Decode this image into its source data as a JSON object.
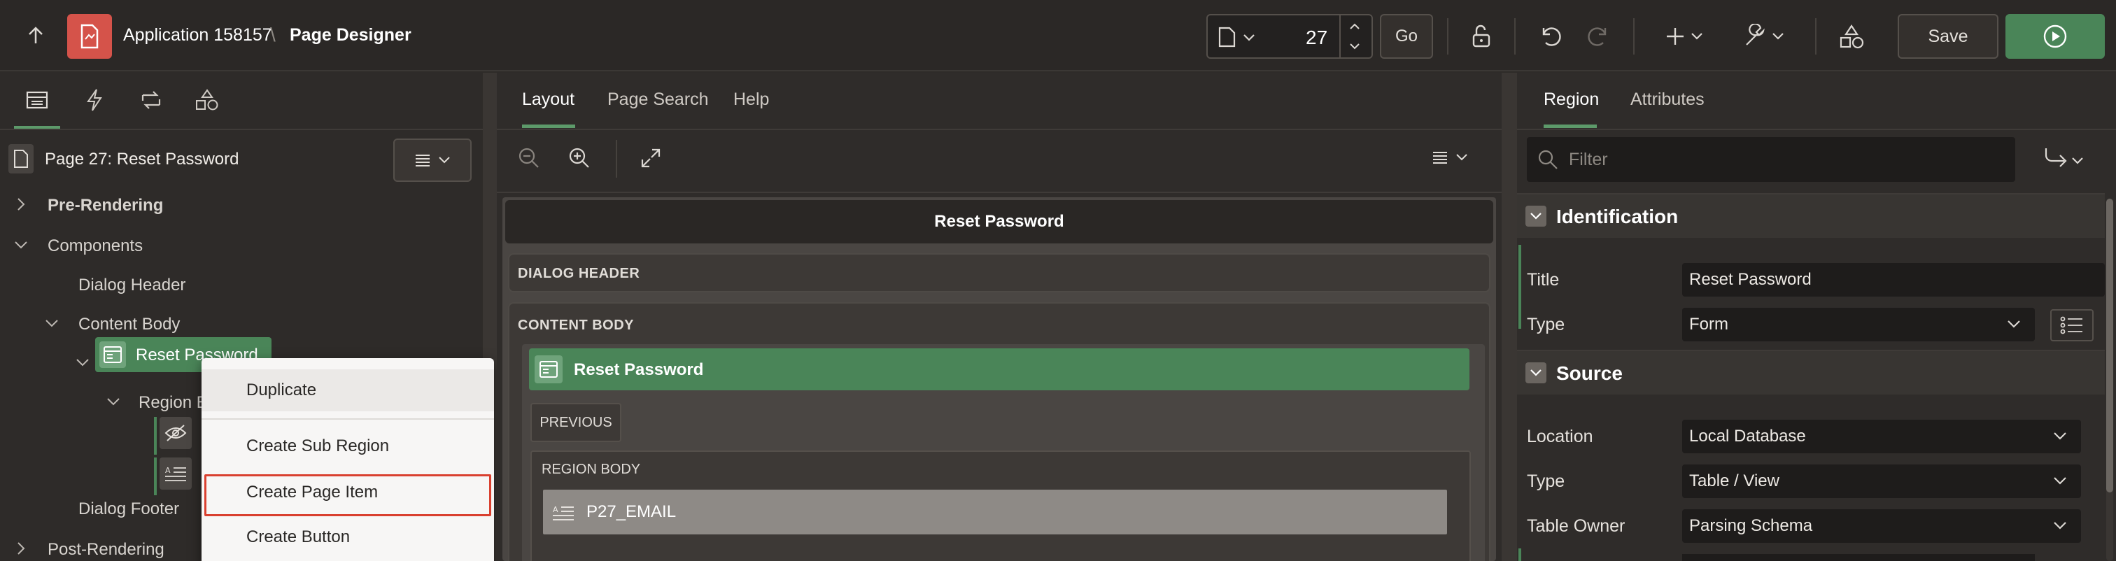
{
  "header": {
    "app_name": "Application 158157",
    "separator": "\\",
    "page_designer": "Page Designer",
    "page_number": "27",
    "go_label": "Go",
    "save_label": "Save"
  },
  "left": {
    "tabs": [
      "rendering-icon",
      "dynamic-actions-icon",
      "processing-icon",
      "shared-components-icon"
    ],
    "page_title": "Page 27: Reset Password",
    "tree": {
      "pre_rendering": "Pre-Rendering",
      "components": "Components",
      "dialog_header": "Dialog Header",
      "content_body": "Content Body",
      "reset_password": "Reset Password",
      "region_body": "Region B",
      "dialog_footer": "Dialog Footer",
      "post_rendering": "Post-Rendering"
    }
  },
  "context_menu": {
    "items": [
      "Duplicate",
      "Create Sub Region",
      "Create Page Item",
      "Create Button"
    ]
  },
  "middle": {
    "tabs": {
      "layout": "Layout",
      "page_search": "Page Search",
      "help": "Help"
    },
    "page_title_bar": "Reset Password",
    "dialog_header": "DIALOG HEADER",
    "content_body": "CONTENT BODY",
    "region_title": "Reset Password",
    "previous": "PREVIOUS",
    "region_body": "REGION BODY",
    "item": "P27_EMAIL"
  },
  "right": {
    "tabs": {
      "region": "Region",
      "attributes": "Attributes"
    },
    "filter_placeholder": "Filter",
    "sections": {
      "identification": "Identification",
      "source": "Source"
    },
    "props": {
      "title_label": "Title",
      "title_value": "Reset Password",
      "type_label": "Type",
      "type_value": "Form",
      "location_label": "Location",
      "location_value": "Local Database",
      "source_type_label": "Type",
      "source_type_value": "Table / View",
      "table_owner_label": "Table Owner",
      "table_owner_value": "Parsing Schema"
    }
  },
  "colors": {
    "accent_green": "#4a8558",
    "app_icon_red": "#d5534a",
    "highlight_red": "#d9402f"
  }
}
